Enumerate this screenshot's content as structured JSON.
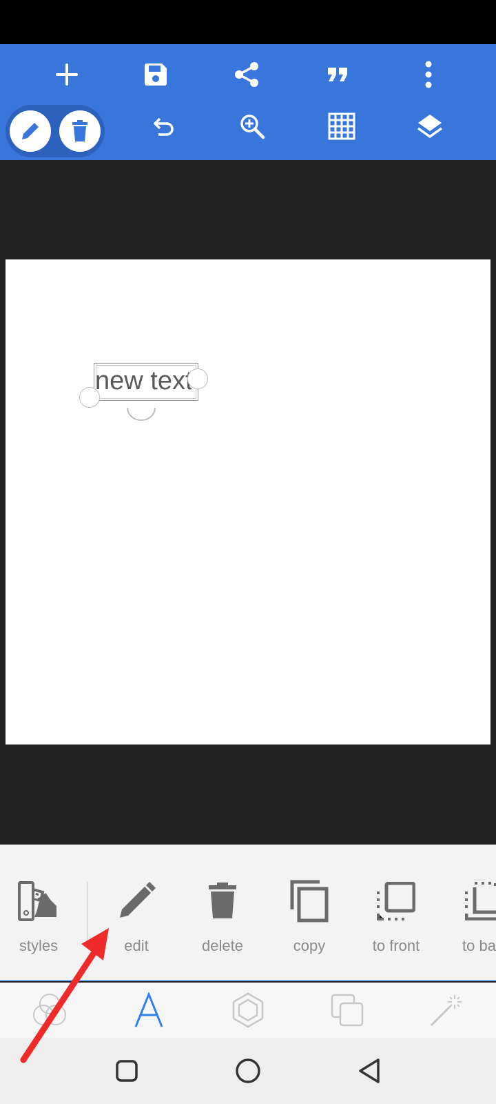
{
  "toolbar": {
    "top_row": [
      "add-icon",
      "save-icon",
      "share-icon",
      "quote-icon",
      "more-vert-icon"
    ],
    "bottom_row": [
      "pencil-icon",
      "trash-icon",
      "undo-icon",
      "zoom-in-icon",
      "grid-icon",
      "layers-icon"
    ],
    "color": "#3876DB"
  },
  "canvas": {
    "text_object": "new text"
  },
  "actions": [
    {
      "label": "styles",
      "icon": "swatch-icon"
    },
    {
      "label": "edit",
      "icon": "pencil-icon"
    },
    {
      "label": "delete",
      "icon": "trash-icon"
    },
    {
      "label": "copy",
      "icon": "copy-icon"
    },
    {
      "label": "to front",
      "icon": "bring-to-front-icon"
    },
    {
      "label": "to bac",
      "icon": "send-to-back-icon"
    }
  ],
  "tabs": [
    {
      "icon": "color-circles-icon",
      "active": false
    },
    {
      "icon": "letter-a-icon",
      "active": true
    },
    {
      "icon": "hexagon-icon",
      "active": false
    },
    {
      "icon": "layers-square-icon",
      "active": false
    },
    {
      "icon": "magic-wand-icon",
      "active": false
    }
  ],
  "nav": [
    "recent-apps-icon",
    "home-icon",
    "back-icon"
  ],
  "colors": {
    "accent": "#3876DB",
    "active_tab": "#2F80ED",
    "annotation_arrow": "#EE2A2A"
  }
}
